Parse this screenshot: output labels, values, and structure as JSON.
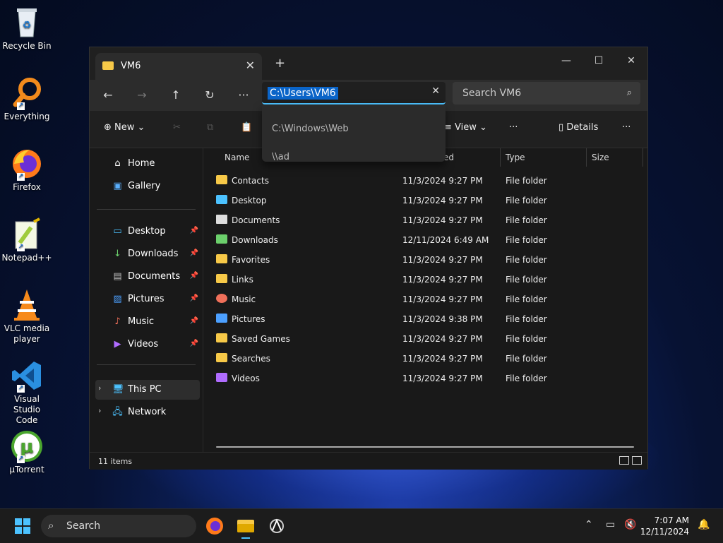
{
  "desktop": {
    "icons": [
      {
        "label": "Recycle Bin"
      },
      {
        "label": "Everything"
      },
      {
        "label": "Firefox"
      },
      {
        "label": "Notepad++"
      },
      {
        "label": "VLC media player"
      },
      {
        "label": "Visual Studio Code"
      },
      {
        "label": "µTorrent"
      }
    ]
  },
  "window": {
    "tab_title": "VM6",
    "address_value": "C:\\Users\\VM6",
    "search_placeholder": "Search VM6",
    "suggestions": [
      "C:\\Windows\\Web",
      "\\\\ad"
    ],
    "toolbar": {
      "new_label": "New",
      "view_label": "View",
      "details_label": "Details"
    },
    "sidebar": {
      "top": [
        {
          "label": "Home",
          "icon": "home-icon"
        },
        {
          "label": "Gallery",
          "icon": "gallery-icon"
        }
      ],
      "pinned": [
        {
          "label": "Desktop",
          "icon": "desktop-icon"
        },
        {
          "label": "Downloads",
          "icon": "download-icon"
        },
        {
          "label": "Documents",
          "icon": "document-icon"
        },
        {
          "label": "Pictures",
          "icon": "pictures-icon"
        },
        {
          "label": "Music",
          "icon": "music-icon"
        },
        {
          "label": "Videos",
          "icon": "videos-icon"
        }
      ],
      "bottom": [
        {
          "label": "This PC",
          "icon": "this-pc-icon"
        },
        {
          "label": "Network",
          "icon": "network-icon"
        }
      ]
    },
    "columns": {
      "name": "Name",
      "date": "ed",
      "type": "Type",
      "size": "Size"
    },
    "files": [
      {
        "name": "Contacts",
        "date": "11/3/2024 9:27 PM",
        "type": "File folder",
        "icon": "folder-icon"
      },
      {
        "name": "Desktop",
        "date": "11/3/2024 9:27 PM",
        "type": "File folder",
        "icon": "desktop-icon"
      },
      {
        "name": "Documents",
        "date": "11/3/2024 9:27 PM",
        "type": "File folder",
        "icon": "document-icon"
      },
      {
        "name": "Downloads",
        "date": "12/11/2024 6:49 AM",
        "type": "File folder",
        "icon": "download-icon"
      },
      {
        "name": "Favorites",
        "date": "11/3/2024 9:27 PM",
        "type": "File folder",
        "icon": "folder-icon"
      },
      {
        "name": "Links",
        "date": "11/3/2024 9:27 PM",
        "type": "File folder",
        "icon": "folder-icon"
      },
      {
        "name": "Music",
        "date": "11/3/2024 9:27 PM",
        "type": "File folder",
        "icon": "music-icon"
      },
      {
        "name": "Pictures",
        "date": "11/3/2024 9:38 PM",
        "type": "File folder",
        "icon": "pictures-icon"
      },
      {
        "name": "Saved Games",
        "date": "11/3/2024 9:27 PM",
        "type": "File folder",
        "icon": "folder-icon"
      },
      {
        "name": "Searches",
        "date": "11/3/2024 9:27 PM",
        "type": "File folder",
        "icon": "folder-icon"
      },
      {
        "name": "Videos",
        "date": "11/3/2024 9:27 PM",
        "type": "File folder",
        "icon": "videos-icon"
      }
    ],
    "status": "11 items"
  },
  "taskbar": {
    "search_label": "Search",
    "time": "7:07 AM",
    "date": "12/11/2024"
  },
  "colors": {
    "accent": "#4cc2ff",
    "selection": "#0a64c8",
    "folder": "#f7c948"
  }
}
